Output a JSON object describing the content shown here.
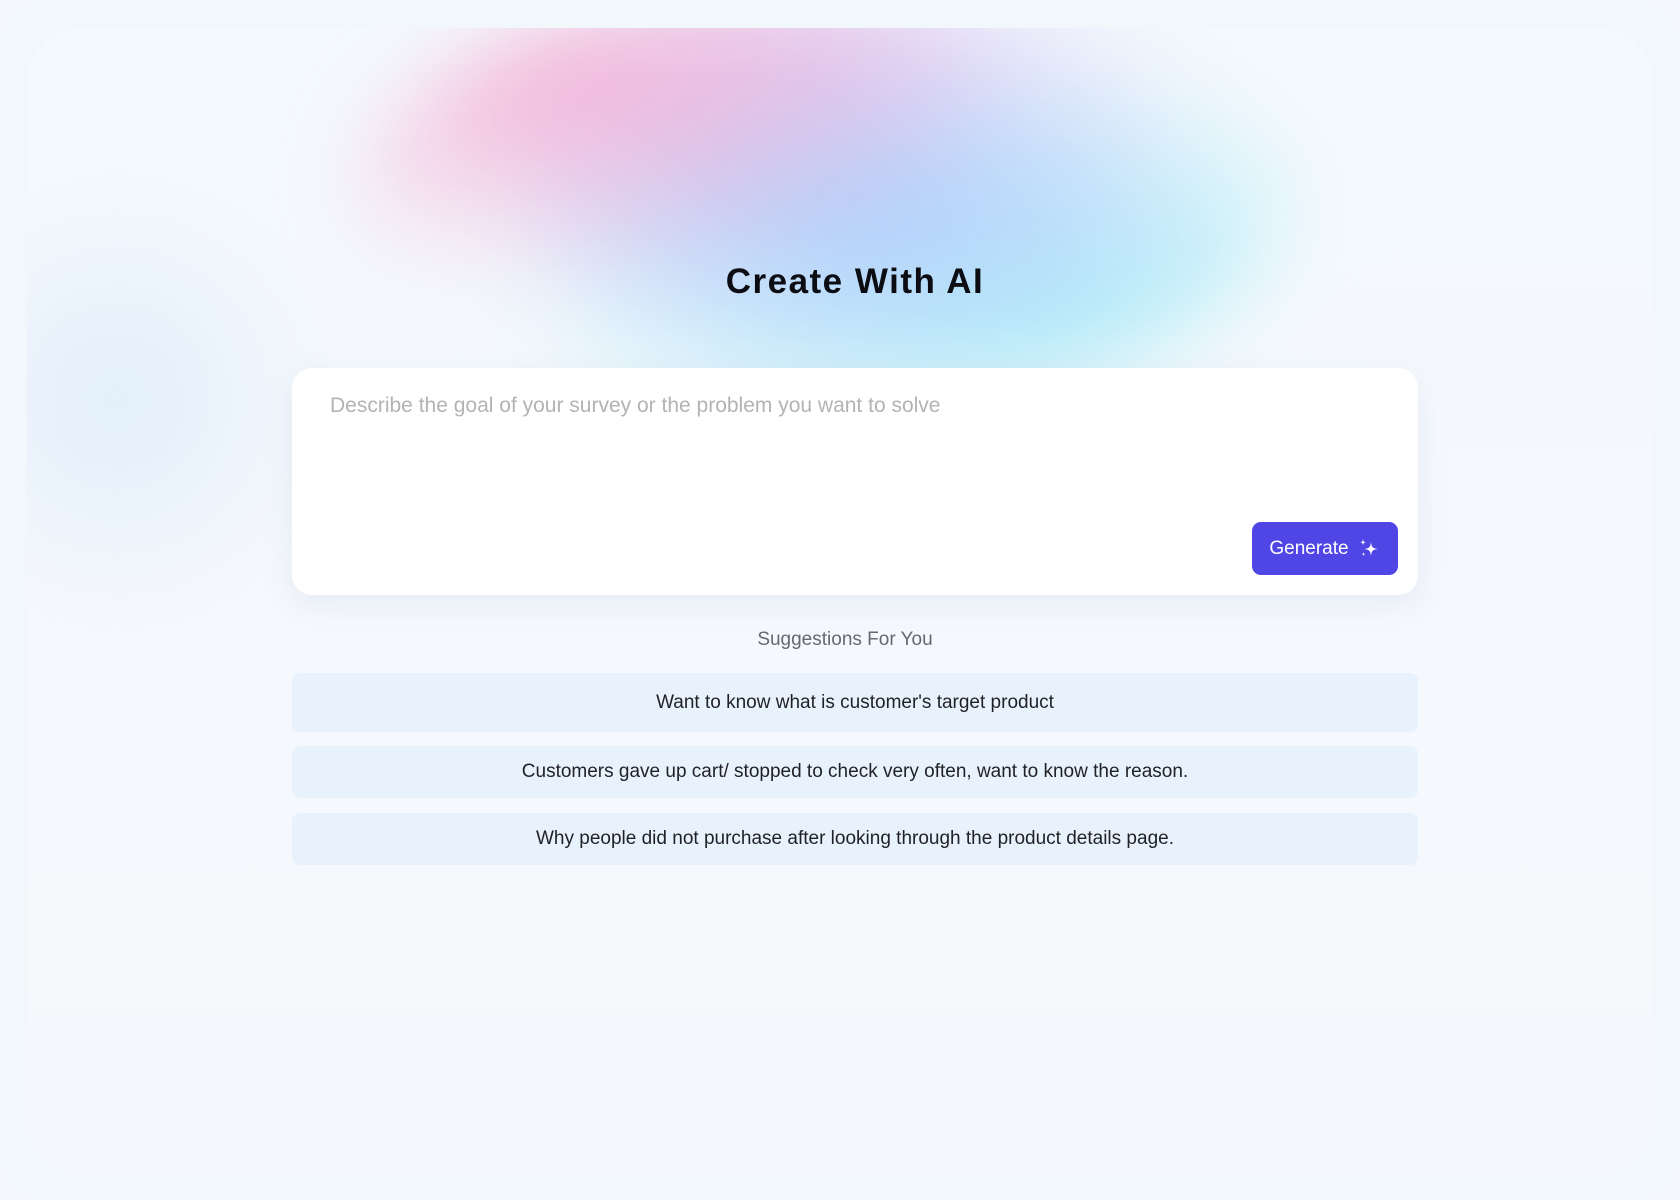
{
  "title": "Create With AI",
  "prompt": {
    "placeholder": "Describe the goal of your survey or the problem you want to solve",
    "value": ""
  },
  "generate_button": {
    "label": "Generate",
    "icon": "sparkle-icon"
  },
  "suggestions": {
    "heading": "Suggestions For You",
    "items": [
      "Want to know what is customer's target product",
      "Customers gave up cart/ stopped to check very often, want to know the reason.",
      "Why people did not purchase after looking through the product details page."
    ]
  },
  "colors": {
    "accent": "#4f46e5",
    "suggestion_bg": "#e8f2fd",
    "card_bg": "#ffffff"
  }
}
